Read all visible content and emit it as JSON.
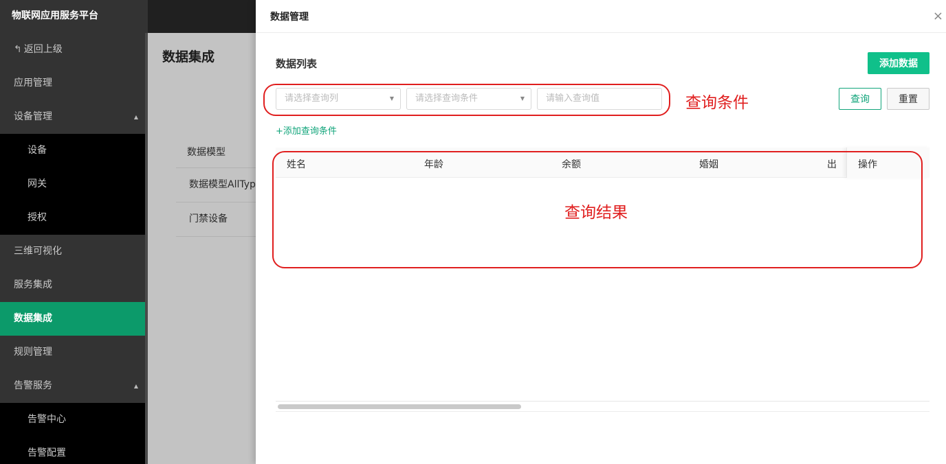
{
  "app": {
    "brand": "物联网应用服务平台"
  },
  "sidebar": {
    "items": [
      {
        "label": "返回上级",
        "type": "back"
      },
      {
        "label": "应用管理"
      },
      {
        "label": "设备管理",
        "expandable": true
      },
      {
        "label": "设备",
        "sub": true
      },
      {
        "label": "网关",
        "sub": true
      },
      {
        "label": "授权",
        "sub": true
      },
      {
        "label": "三维可视化"
      },
      {
        "label": "服务集成"
      },
      {
        "label": "数据集成",
        "active": true
      },
      {
        "label": "规则管理"
      },
      {
        "label": "告警服务",
        "expandable": true
      },
      {
        "label": "告警中心",
        "sub": true
      },
      {
        "label": "告警配置",
        "sub": true
      }
    ]
  },
  "main": {
    "title": "数据集成",
    "model_header": "数据模型",
    "models": [
      "数据模型AllType",
      "门禁设备"
    ]
  },
  "drawer": {
    "title": "数据管理",
    "close": "×",
    "section_title": "数据列表",
    "add_button": "添加数据",
    "filters": {
      "column_placeholder": "请选择查询列",
      "condition_placeholder": "请选择查询条件",
      "value_placeholder": "请输入查询值"
    },
    "query_button": "查询",
    "reset_button": "重置",
    "add_condition": "+添加查询条件",
    "table": {
      "columns": [
        "姓名",
        "年龄",
        "余额",
        "婚姻",
        "出"
      ],
      "fixed_column": "操作"
    },
    "annotations": {
      "condition": "查询条件",
      "result": "查询结果"
    }
  },
  "colors": {
    "accent": "#10c08a",
    "active_nav": "#0c9a6a",
    "annotation": "#e01e1e"
  }
}
